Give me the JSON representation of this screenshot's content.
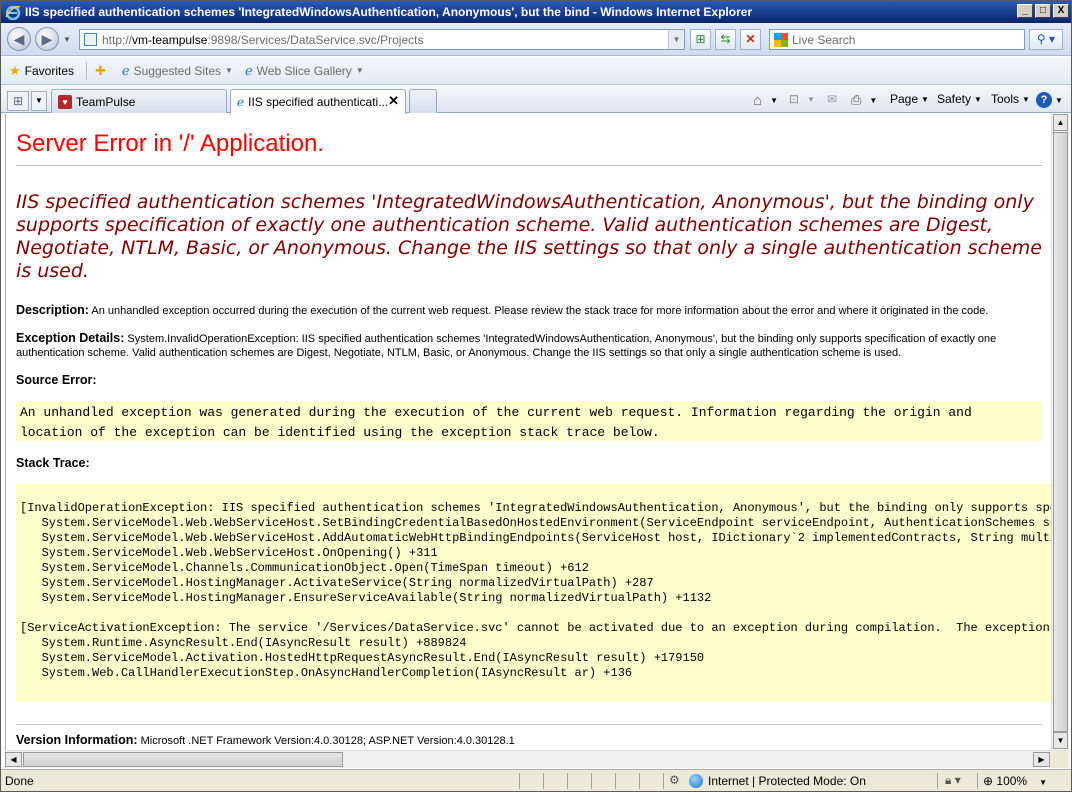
{
  "window": {
    "title": "IIS specified authentication schemes 'IntegratedWindowsAuthentication, Anonymous', but the bind - Windows Internet Explorer",
    "minimize": "_",
    "maximize": "□",
    "close": "X"
  },
  "nav": {
    "url_prefix": "http://",
    "url_host": "vm-teampulse",
    "url_rest": ":9898/Services/DataService.svc/Projects",
    "search_placeholder": "Live Search"
  },
  "favorites": {
    "favorites_label": "Favorites",
    "suggested_label": "Suggested Sites",
    "gallery_label": "Web Slice Gallery"
  },
  "tabs": [
    {
      "label": "TeamPulse"
    },
    {
      "label": "IIS specified authenticati..."
    }
  ],
  "commands": {
    "page": "Page",
    "safety": "Safety",
    "tools": "Tools"
  },
  "page": {
    "heading": "Server Error in '/' Application.",
    "error_message": "IIS specified authentication schemes 'IntegratedWindowsAuthentication, Anonymous', but the binding only supports specification of exactly one authentication scheme. Valid authentication schemes are Digest, Negotiate, NTLM, Basic, or Anonymous. Change the IIS settings so that only a single authentication scheme is used.",
    "description_label": "Description:",
    "description_text": " An unhandled exception occurred during the execution of the current web request. Please review the stack trace for more information about the error and where it originated in the code.",
    "exception_label": "Exception Details:",
    "exception_text": " System.InvalidOperationException: IIS specified authentication schemes 'IntegratedWindowsAuthentication, Anonymous', but the binding only supports specification of exactly one authentication scheme. Valid authentication schemes are Digest, Negotiate, NTLM, Basic, or Anonymous. Change the IIS settings so that only a single authentication scheme is used.",
    "source_error_label": "Source Error:",
    "source_error_text": "An unhandled exception was generated during the execution of the current web request. Information regarding the origin and\nlocation of the exception can be identified using the exception stack trace below.",
    "stack_trace_label": "Stack Trace:",
    "stack_trace_text": "[InvalidOperationException: IIS specified authentication schemes 'IntegratedWindowsAuthentication, Anonymous', but the binding only supports specifi\n   System.ServiceModel.Web.WebServiceHost.SetBindingCredentialBasedOnHostedEnvironment(ServiceEndpoint serviceEndpoint, AuthenticationSchemes suppor\n   System.ServiceModel.Web.WebServiceHost.AddAutomaticWebHttpBindingEndpoints(ServiceHost host, IDictionary`2 implementedContracts, String multipleC\n   System.ServiceModel.Web.WebServiceHost.OnOpening() +311\n   System.ServiceModel.Channels.CommunicationObject.Open(TimeSpan timeout) +612\n   System.ServiceModel.HostingManager.ActivateService(String normalizedVirtualPath) +287\n   System.ServiceModel.HostingManager.EnsureServiceAvailable(String normalizedVirtualPath) +1132\n\n[ServiceActivationException: The service '/Services/DataService.svc' cannot be activated due to an exception during compilation.  The exception mess\n   System.Runtime.AsyncResult.End(IAsyncResult result) +889824\n   System.ServiceModel.Activation.HostedHttpRequestAsyncResult.End(IAsyncResult result) +179150\n   System.Web.CallHandlerExecutionStep.OnAsyncHandlerCompletion(IAsyncResult ar) +136",
    "version_label": "Version Information:",
    "version_text": " Microsoft .NET Framework Version:4.0.30128; ASP.NET Version:4.0.30128.1"
  },
  "status": {
    "left": "Done",
    "zone": "Internet | Protected Mode: On",
    "zoom": "100%"
  },
  "colors": {
    "heading": "#ff0000",
    "error_message": "#800000",
    "code_background": "#ffffcc",
    "titlebar": "#0a246a"
  }
}
